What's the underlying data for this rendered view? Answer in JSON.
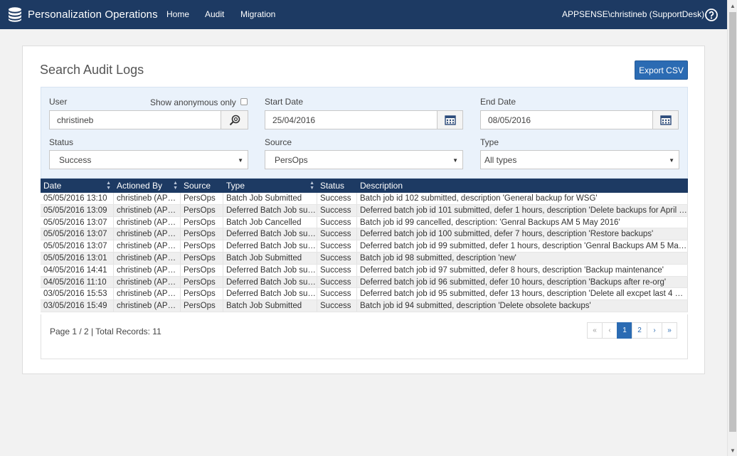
{
  "header": {
    "title": "Personalization Operations",
    "nav": [
      "Home",
      "Audit",
      "Migration"
    ],
    "user": "APPSENSE\\christineb (SupportDesk)"
  },
  "page": {
    "title": "Search Audit Logs",
    "export_label": "Export CSV"
  },
  "filters": {
    "user_label": "User",
    "user_value": "christineb",
    "anon_label": "Show anonymous only",
    "start_label": "Start Date",
    "start_value": "25/04/2016",
    "end_label": "End Date",
    "end_value": "08/05/2016",
    "status_label": "Status",
    "status_value": "Success",
    "source_label": "Source",
    "source_value": "PersOps",
    "type_label": "Type",
    "type_value": "All types"
  },
  "table": {
    "columns": [
      "Date",
      "Actioned By",
      "Source",
      "Type",
      "Status",
      "Description"
    ],
    "rows": [
      [
        "05/05/2016 13:10",
        "christineb (APPS...",
        "PersOps",
        "Batch Job Submitted",
        "Success",
        "Batch job id 102 submitted, description 'General backup for WSG'"
      ],
      [
        "05/05/2016 13:09",
        "christineb (APPS...",
        "PersOps",
        "Deferred Batch Job sub...",
        "Success",
        "Deferred batch job id 101 submitted, defer 1 hours, description 'Delete backups for April 2..."
      ],
      [
        "05/05/2016 13:07",
        "christineb (APPS...",
        "PersOps",
        "Batch Job Cancelled",
        "Success",
        "Batch job id 99 cancelled, description: 'Genral Backups AM 5 May 2016'"
      ],
      [
        "05/05/2016 13:07",
        "christineb (APPS...",
        "PersOps",
        "Deferred Batch Job sub...",
        "Success",
        "Deferred batch job id 100 submitted, defer 7 hours, description 'Restore backups'"
      ],
      [
        "05/05/2016 13:07",
        "christineb (APPS...",
        "PersOps",
        "Deferred Batch Job sub...",
        "Success",
        "Deferred batch job id 99 submitted, defer 1 hours, description 'Genral Backups AM 5 May ..."
      ],
      [
        "05/05/2016 13:01",
        "christineb (APPS...",
        "PersOps",
        "Batch Job Submitted",
        "Success",
        "Batch job id 98 submitted, description 'new'"
      ],
      [
        "04/05/2016 14:41",
        "christineb (APPS...",
        "PersOps",
        "Deferred Batch Job sub...",
        "Success",
        "Deferred batch job id 97 submitted, defer 8 hours, description 'Backup maintenance'"
      ],
      [
        "04/05/2016 11:10",
        "christineb (APPS...",
        "PersOps",
        "Deferred Batch Job sub...",
        "Success",
        "Deferred batch job id 96 submitted, defer 10 hours, description 'Backups after re-org'"
      ],
      [
        "03/05/2016 15:53",
        "christineb (APPS...",
        "PersOps",
        "Deferred Batch Job sub...",
        "Success",
        "Deferred batch job id 95 submitted, defer 13 hours, description 'Delete all excpet last 4 WS..."
      ],
      [
        "03/05/2016 15:49",
        "christineb (APPS...",
        "PersOps",
        "Batch Job Submitted",
        "Success",
        "Batch job id 94 submitted, description 'Delete obsolete backups'"
      ]
    ]
  },
  "footer": {
    "page_info": "Page 1 / 2 | Total Records: 11",
    "pager": [
      "«",
      "‹",
      "1",
      "2",
      "›",
      "»"
    ]
  },
  "colors": {
    "navbar": "#1d3a63",
    "accent": "#2b6bb3",
    "filter_bg": "#eaf2fb"
  }
}
